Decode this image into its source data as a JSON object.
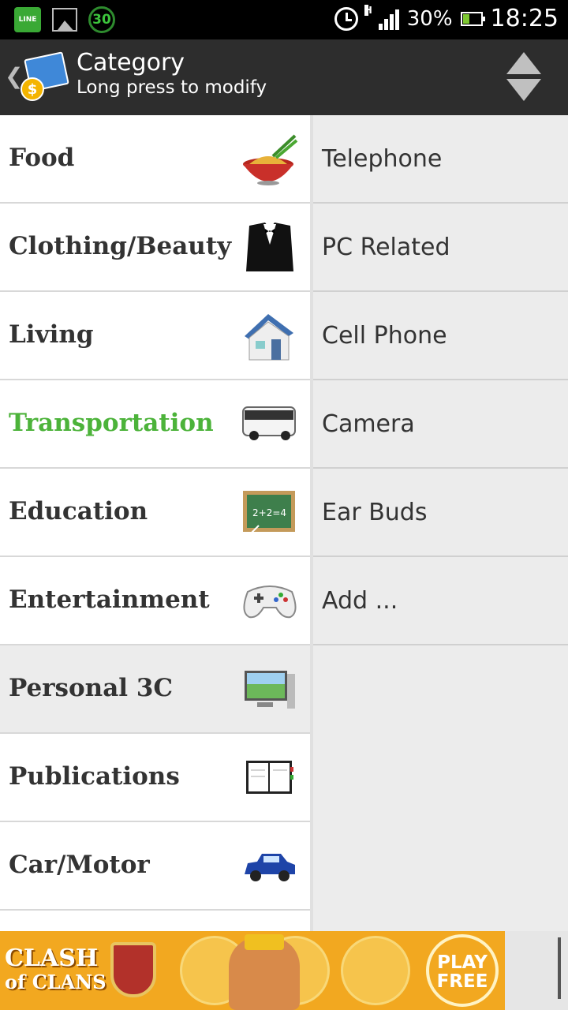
{
  "status_bar": {
    "battery_pct": "30%",
    "time": "18:25",
    "notif_count": "30",
    "line_label": "LINE",
    "network": "H"
  },
  "action_bar": {
    "title": "Category",
    "subtitle": "Long press to modify"
  },
  "categories": [
    {
      "label": "Food",
      "icon": "noodle-bowl-icon",
      "active": false
    },
    {
      "label": "Clothing/Beauty",
      "icon": "tuxedo-icon",
      "active": false
    },
    {
      "label": "Living",
      "icon": "house-icon",
      "active": false
    },
    {
      "label": "Transportation",
      "icon": "bus-icon",
      "active": true
    },
    {
      "label": "Education",
      "icon": "chalkboard-icon",
      "active": false
    },
    {
      "label": "Entertainment",
      "icon": "gamepad-icon",
      "active": false
    },
    {
      "label": "Personal 3C",
      "icon": "monitor-icon",
      "active": false,
      "selected": true
    },
    {
      "label": "Publications",
      "icon": "notebook-icon",
      "active": false
    },
    {
      "label": "Car/Motor",
      "icon": "car-icon",
      "active": false
    }
  ],
  "subcategories": [
    "Telephone",
    "PC Related",
    "Cell Phone",
    "Camera",
    "Ear Buds",
    "Add ..."
  ],
  "ad": {
    "logo_line1": "CLASH",
    "logo_line2": "of CLANS",
    "play_line1": "PLAY",
    "play_line2": "FREE"
  },
  "colors": {
    "active_category": "#4cb33a",
    "action_bar": "#2d2d2d"
  }
}
